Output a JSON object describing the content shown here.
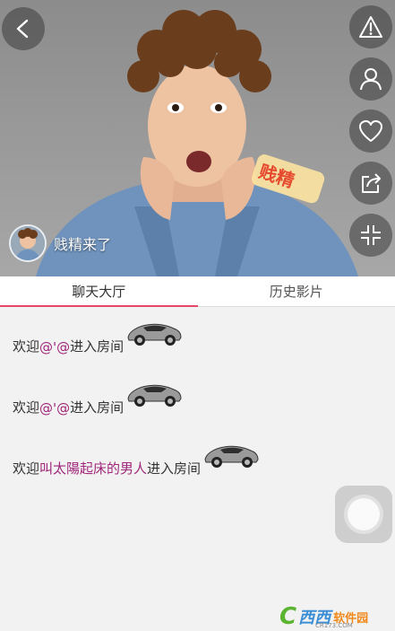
{
  "host": {
    "name": "贱精来了"
  },
  "sticker_text": "贱精",
  "tabs": [
    {
      "label": "聊天大厅",
      "active": true
    },
    {
      "label": "历史影片",
      "active": false
    }
  ],
  "messages": [
    {
      "prefix": "欢迎",
      "user": "@'@",
      "suffix": "进入房间"
    },
    {
      "prefix": "欢迎",
      "user": "@'@",
      "suffix": "进入房间"
    },
    {
      "prefix": "欢迎",
      "user": "叫太陽起床的男人",
      "suffix": "进入房间"
    }
  ],
  "watermark": {
    "part1": "C",
    "part2": "西西",
    "part3": "软件园",
    "sub": "CR173.COM"
  },
  "colors": {
    "accent": "#e8456b",
    "username": "#a0267a",
    "background": "#f2f2f2"
  },
  "icons": [
    "back-arrow-icon",
    "warning-icon",
    "person-icon",
    "heart-icon",
    "share-icon",
    "collapse-icon",
    "car-icon"
  ]
}
